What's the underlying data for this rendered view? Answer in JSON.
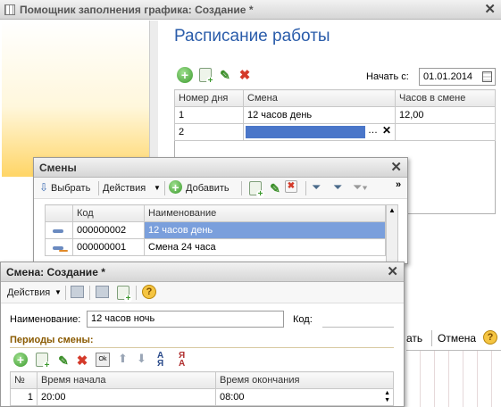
{
  "main_window": {
    "title": "Помощник заполнения графика: Создание *",
    "heading": "Расписание работы",
    "start_label": "Начать с:",
    "start_value": "01.01.2014",
    "columns": [
      "Номер дня",
      "Смена",
      "Часов в смене"
    ],
    "rows": [
      {
        "day": "1",
        "shift": "12 часов день",
        "hours": "12,00"
      },
      {
        "day": "2",
        "shift": "",
        "hours": ""
      }
    ],
    "right_buttons": [
      "ать",
      "Отмена"
    ]
  },
  "shifts_window": {
    "title": "Смены",
    "toolbar": {
      "select": "Выбрать",
      "actions": "Действия",
      "add": "Добавить"
    },
    "columns": [
      "Код",
      "Наименование"
    ],
    "rows": [
      {
        "code": "000000002",
        "name": "12 часов день"
      },
      {
        "code": "000000001",
        "name": "Смена 24 часа"
      }
    ]
  },
  "shift_create": {
    "title": "Смена: Создание *",
    "actions_label": "Действия",
    "name_label": "Наименование:",
    "name_value": "12 часов ночь",
    "code_label": "Код:",
    "code_value": "",
    "periods_label": "Периоды смены:",
    "columns": [
      "№",
      "Время начала",
      "Время окончания"
    ],
    "rows": [
      {
        "num": "1",
        "start": "20:00",
        "end": "08:00"
      }
    ]
  },
  "colors": {
    "accent_title": "#2a5caa",
    "selection": "#7a9fdc",
    "gold": "#8a5a00"
  }
}
